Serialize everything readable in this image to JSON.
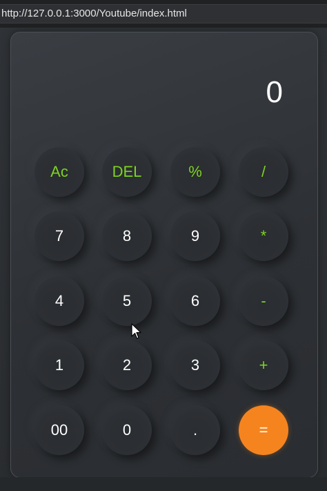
{
  "browser": {
    "url": "http://127.0.0.1:3000/Youtube/index.html"
  },
  "calculator": {
    "display_value": "0",
    "keys": [
      [
        "Ac",
        "DEL",
        "%",
        "/"
      ],
      [
        "7",
        "8",
        "9",
        "*"
      ],
      [
        "4",
        "5",
        "6",
        "-"
      ],
      [
        "1",
        "2",
        "3",
        "+"
      ],
      [
        "00",
        "0",
        ".",
        "="
      ]
    ]
  },
  "colors": {
    "operator": "#7ed321",
    "equal_button": "#f5841f",
    "digit": "#ffffff"
  },
  "icons": {
    "cursor": "mouse-pointer-icon"
  }
}
